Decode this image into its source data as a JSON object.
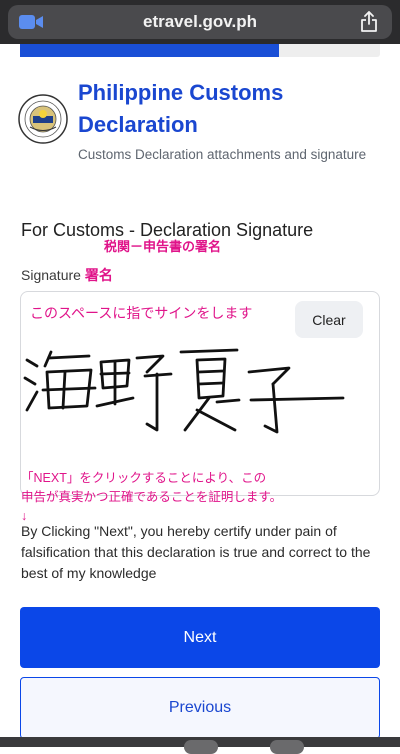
{
  "browser": {
    "url": "etravel.gov.ph",
    "left_icon": "camera-icon",
    "right_icon": "share-icon"
  },
  "progress": {
    "fraction": 0.72,
    "color": "#1a4fd6"
  },
  "header": {
    "title": "Philippine Customs Declaration",
    "subtitle": "Customs Declaration attachments and signature",
    "logo": "bureau-of-customs-seal"
  },
  "section": {
    "heading": "For Customs - Declaration Signature",
    "note_jp": "税関－申告書の署名"
  },
  "signature": {
    "label": "Signature",
    "label_jp": "署名",
    "clear_label": "Clear",
    "pad_note_jp": "このスペースに指でサインをします",
    "handwritten": "海野夏子"
  },
  "certify": {
    "note_jp_line1": "「NEXT」をクリックすることにより、この",
    "note_jp_line2": "申告が真実かつ正確であることを証明します。",
    "arrow": "↓",
    "text": "By Clicking \"Next\", you hereby certify under pain of falsification that this declaration is true and correct to the best of my knowledge"
  },
  "buttons": {
    "next": "Next",
    "previous": "Previous"
  },
  "colors": {
    "accent": "#0b47e8",
    "annotation": "#e0148a",
    "title": "#1a47d0"
  }
}
